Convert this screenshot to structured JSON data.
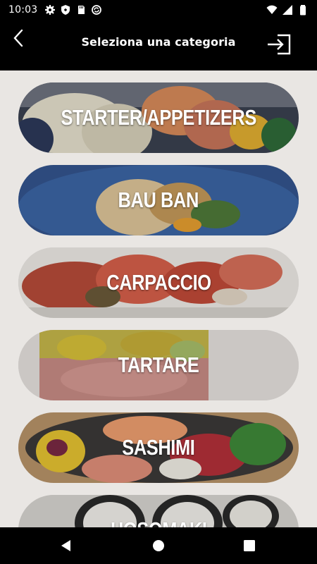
{
  "status_bar": {
    "time": "10:03",
    "left_icons": [
      "gear-icon",
      "shield-icon",
      "sd-card-icon",
      "sync-icon"
    ],
    "right_icons": [
      "wifi-icon",
      "signal-icon",
      "battery-icon"
    ]
  },
  "header": {
    "title": "Seleziona una categoria",
    "back_icon": "chevron-left-icon",
    "logout_icon": "logout-icon"
  },
  "categories": [
    {
      "label": "STARTER/APPETIZERS"
    },
    {
      "label": "BAU BAN"
    },
    {
      "label": "CARPACCIO"
    },
    {
      "label": "TARTARE"
    },
    {
      "label": "SASHIMI"
    },
    {
      "label": "HOSOMAKI"
    }
  ],
  "nav_bar": {
    "icons": [
      "back-triangle-icon",
      "home-circle-icon",
      "recents-square-icon"
    ]
  },
  "colors": {
    "header_bg": "#000000",
    "page_bg": "#e9e6e3",
    "label_text": "#ffffff"
  }
}
